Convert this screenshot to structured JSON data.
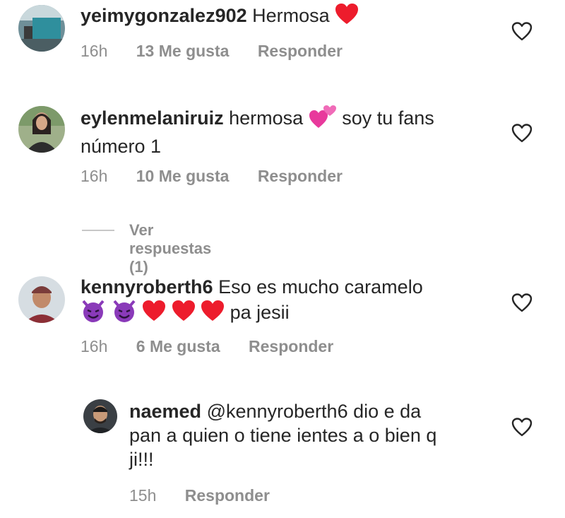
{
  "colors": {
    "text": "#262626",
    "muted": "#8e8e8e",
    "heart_red": "#ed1c2c",
    "purple_devil": "#8a3ab9"
  },
  "comments": [
    {
      "username": "yeimygonzalez902",
      "text": "Hermosa",
      "emoji": [
        "red-heart"
      ],
      "time": "16h",
      "likes": "13 Me gusta",
      "reply": "Responder"
    },
    {
      "username": "eylenmelaniruiz",
      "text_a": "hermosa",
      "text_b": "soy tu fans",
      "text_line2": "número 1",
      "emoji": [
        "two-hearts"
      ],
      "time": "16h",
      "likes": "10 Me gusta",
      "reply": "Responder",
      "view_replies": "Ver respuestas (1)"
    },
    {
      "username": "kennyroberth6",
      "text": "Eso es mucho caramelo",
      "text_line2": "pa jesii",
      "emoji": [
        "smiling-imp",
        "smiling-imp",
        "red-heart",
        "red-heart",
        "red-heart"
      ],
      "time": "16h",
      "likes": "6 Me gusta",
      "reply": "Responder"
    },
    {
      "username": "naemed",
      "mention": "@kennyroberth6",
      "text": "dio e da",
      "text_line2": "pan a quien o tiene ientes a o bien q",
      "text_line3": "ji!!!",
      "time": "15h",
      "reply": "Responder"
    }
  ]
}
